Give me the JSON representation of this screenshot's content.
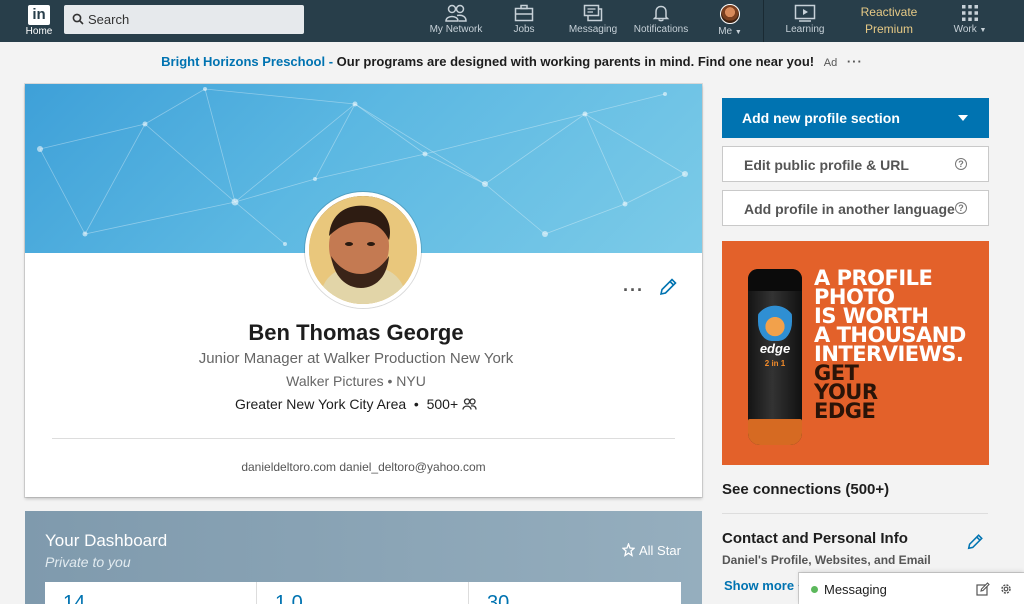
{
  "nav": {
    "logo": "in",
    "home": "Home",
    "search_placeholder": "Search",
    "my_network": "My Network",
    "jobs": "Jobs",
    "messaging": "Messaging",
    "notifications": "Notifications",
    "me": "Me",
    "learning": "Learning",
    "premium_line1": "Reactivate",
    "premium_line2": "Premium",
    "work": "Work"
  },
  "ad_line": {
    "brand": "Bright Horizons Preschool -",
    "message": "Our programs are designed with working parents in mind. Find one near you!",
    "tag": "Ad",
    "more": "···"
  },
  "profile": {
    "more": "···",
    "name": "Ben Thomas George",
    "headline": "Junior Manager at Walker Production New York",
    "company_school": "Walker Pictures • NYU",
    "location": "Greater New York City Area",
    "connections": "500+",
    "contact": "danieldeltoro.com daniel_deltoro@yahoo.com"
  },
  "dashboard": {
    "title": "Your Dashboard",
    "subtitle": "Private to you",
    "all_star": "All Star",
    "stats": [
      "14",
      "1.0",
      "30"
    ]
  },
  "right_rail": {
    "add_section": "Add new profile section",
    "edit_public": "Edit public profile & URL",
    "add_language": "Add profile in another language",
    "help": "?",
    "ad": {
      "product_logo": "edge",
      "product_sub": "2 in 1",
      "line1": "A PROFILE",
      "line2": "PHOTO",
      "line3": "IS WORTH",
      "line4": "A THOUSAND",
      "line5": "INTERVIEWS.",
      "line6": "GET",
      "line7": "YOUR",
      "line8": "EDGE"
    },
    "see_connections": "See connections (500+)",
    "contact_title": "Contact and Personal Info",
    "contact_sub": "Daniel's Profile, Websites, and Email",
    "show_more": "Show more"
  },
  "messaging_tab": {
    "label": "Messaging"
  },
  "colors": {
    "nav_bg": "#283e4a",
    "brand_blue": "#0073b1",
    "premium_gold": "#e6c985",
    "ad_orange": "#e3612a",
    "online_green": "#5cb85c"
  }
}
